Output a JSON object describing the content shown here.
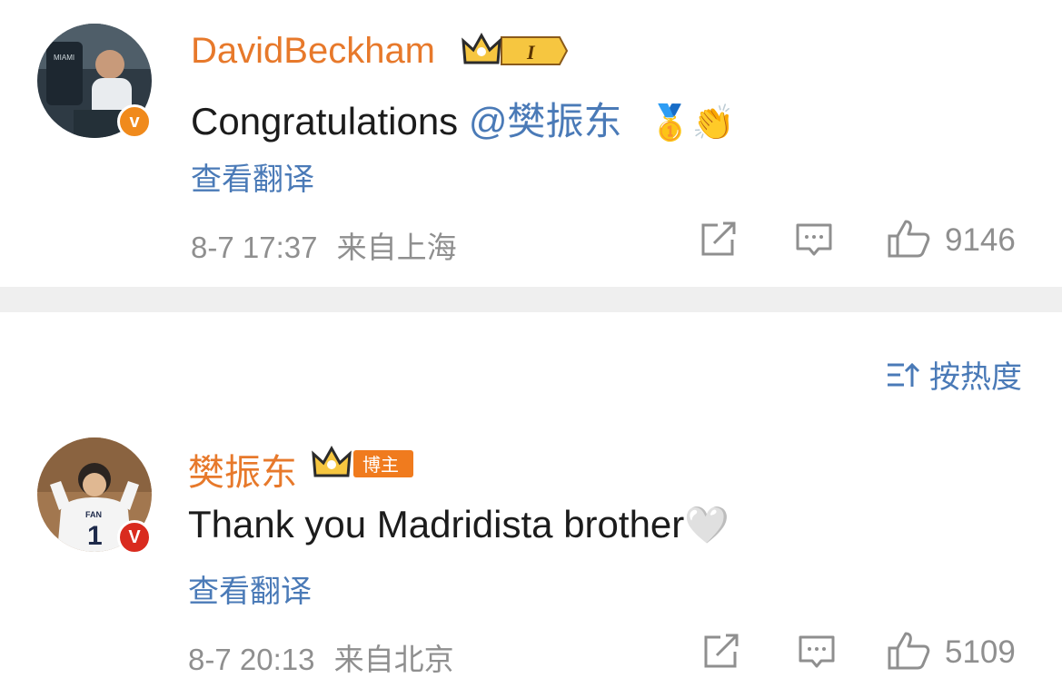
{
  "comments": [
    {
      "username": "DavidBeckham",
      "text": "Congratulations ",
      "mention": "@樊振东",
      "emoji": "🥇👏",
      "translate_label": "查看翻译",
      "date": "8-7 17:37",
      "location": "来自上海",
      "likes": "9146",
      "badge_label": "I"
    },
    {
      "username": "樊振东",
      "text": "Thank you Madridista brother",
      "emoji": "🤍",
      "translate_label": "查看翻译",
      "date": "8-7 20:13",
      "location": "来自北京",
      "likes": "5109",
      "badge_label": "博主"
    }
  ],
  "sort": {
    "label": "按热度"
  },
  "colors": {
    "username": "#e7792b",
    "link": "#4a7ab7",
    "meta": "#8f8f8f",
    "divider": "#efefef",
    "crown": "#f2c64c"
  },
  "icons": [
    "verified-badge-icon",
    "crown-icon",
    "share-icon",
    "reply-icon",
    "thumbs-up-icon",
    "sort-icon"
  ]
}
